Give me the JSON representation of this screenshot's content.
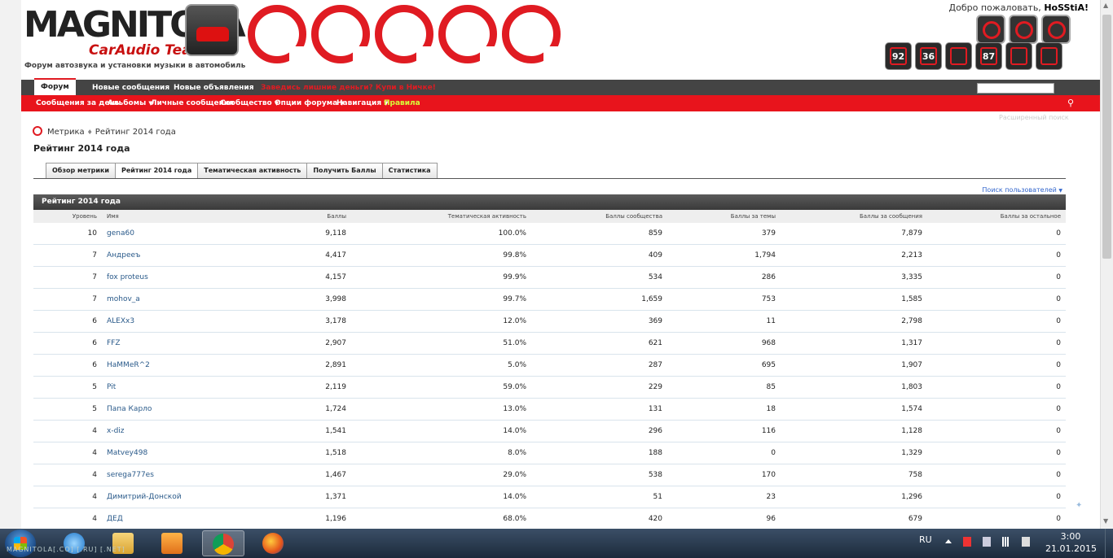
{
  "header": {
    "logo_text": "MAGNITOLA",
    "logo_sub": "CarAudio Team",
    "tagline": "Форум автозвука и установки музыки в автомобиль",
    "welcome_prefix": "Добро пожаловать,",
    "username": "HoSStiA!",
    "counters": [
      "92",
      "36",
      "",
      "87",
      "",
      ""
    ]
  },
  "nav": {
    "tabs": [
      "Форум",
      "Новые сообщения",
      "Новые объявления"
    ],
    "promo": "Заведись лишние деньги? Купи в Ничке!",
    "sub_items": [
      {
        "label": "Сообщения за день",
        "caret": false
      },
      {
        "label": "Альбомы",
        "caret": true
      },
      {
        "label": "Личные сообщения",
        "caret": false
      },
      {
        "label": "Сообщество",
        "caret": true
      },
      {
        "label": "Опции форума",
        "caret": true
      },
      {
        "label": "Навигация",
        "caret": true
      },
      {
        "label": "Правила",
        "caret": false
      }
    ],
    "advanced_search": "Расширенный поиск"
  },
  "breadcrumb": {
    "root": "Метрика",
    "current": "Рейтинг 2014 года"
  },
  "page_title": "Рейтинг 2014 года",
  "subtabs": [
    "Обзор метрики",
    "Рейтинг 2014 года",
    "Тематическая активность",
    "Получить Баллы",
    "Статистика"
  ],
  "active_subtab": 1,
  "user_search": "Поиск пользователей",
  "block_title": "Рейтинг 2014 года",
  "table": {
    "columns": [
      "Уровень",
      "Имя",
      "Баллы",
      "Тематическая активность",
      "Баллы сообщества",
      "Баллы за темы",
      "Баллы за сообщения",
      "Баллы за остальное"
    ],
    "rows": [
      [
        "10",
        "gena60",
        "9,118",
        "100.0%",
        "859",
        "379",
        "7,879",
        "0"
      ],
      [
        "7",
        "Андрееъ",
        "4,417",
        "99.8%",
        "409",
        "1,794",
        "2,213",
        "0"
      ],
      [
        "7",
        "fox proteus",
        "4,157",
        "99.9%",
        "534",
        "286",
        "3,335",
        "0"
      ],
      [
        "7",
        "mohov_a",
        "3,998",
        "99.7%",
        "1,659",
        "753",
        "1,585",
        "0"
      ],
      [
        "6",
        "ALEXx3",
        "3,178",
        "12.0%",
        "369",
        "11",
        "2,798",
        "0"
      ],
      [
        "6",
        "FFZ",
        "2,907",
        "51.0%",
        "621",
        "968",
        "1,317",
        "0"
      ],
      [
        "6",
        "HaMMeR^2",
        "2,891",
        "5.0%",
        "287",
        "695",
        "1,907",
        "0"
      ],
      [
        "5",
        "Pit",
        "2,119",
        "59.0%",
        "229",
        "85",
        "1,803",
        "0"
      ],
      [
        "5",
        "Папа Карло",
        "1,724",
        "13.0%",
        "131",
        "18",
        "1,574",
        "0"
      ],
      [
        "4",
        "x-diz",
        "1,541",
        "14.0%",
        "296",
        "116",
        "1,128",
        "0"
      ],
      [
        "4",
        "Matvey498",
        "1,518",
        "8.0%",
        "188",
        "0",
        "1,329",
        "0"
      ],
      [
        "4",
        "serega777es",
        "1,467",
        "29.0%",
        "538",
        "170",
        "758",
        "0"
      ],
      [
        "4",
        "Димитрий-Донской",
        "1,371",
        "14.0%",
        "51",
        "23",
        "1,296",
        "0"
      ],
      [
        "4",
        "ДЕД",
        "1,196",
        "68.0%",
        "420",
        "96",
        "679",
        "0"
      ]
    ]
  },
  "taskbar": {
    "overlay_text": "MAGNITOLA[.CO] [.RU] [.NET]",
    "lang": "RU",
    "time": "3:00",
    "date": "21.01.2015"
  }
}
